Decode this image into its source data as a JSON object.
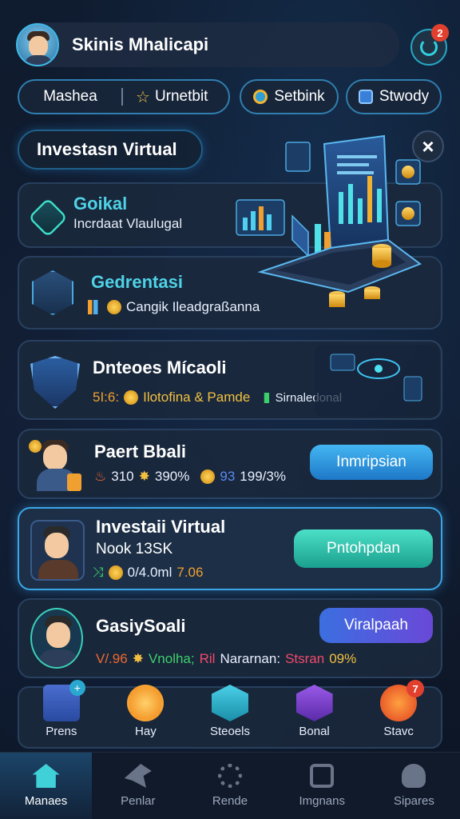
{
  "header": {
    "title": "Skinis Mhalicapi",
    "notification_count": "2"
  },
  "filters": {
    "seg1": "Mashea",
    "seg2": "Urnetbit",
    "pill2": "Setbink",
    "pill3": "Stwody"
  },
  "section": {
    "title": "Investasn Virtual",
    "close_icon": "×"
  },
  "cards": [
    {
      "title": "Goikal",
      "subtitle": "Incrdaat Vlaulugal",
      "title_color": "#4fd2e6"
    },
    {
      "title": "Gedrentasi",
      "subtitle": "Cangik Ileadgraßanna",
      "title_color": "#4fd2e6"
    },
    {
      "title": "Dnteoes Mícaoli",
      "stat1": "5Ι:6:",
      "stat2": "Ilotofina & Pamde",
      "stat3": "Sirnaledonal"
    },
    {
      "title": "Paert Bbali",
      "stat1": "310",
      "stat2": "390%",
      "stat3": "93",
      "stat4": "199/3%",
      "button": "Inmripsian"
    },
    {
      "title": "Investaii Virtual",
      "subtitle": "Nook 13SK",
      "stat1": "0/4.0ml",
      "stat2": "7.06",
      "button": "Pntohpdan"
    },
    {
      "title": "GasiySoali",
      "stat1": "V/.96",
      "stat2": "Vnolha;",
      "stat3": "Ril",
      "stat4": "Nararnan:",
      "stat5": "Stsran",
      "stat6": "09%",
      "button": "Viralpaah"
    }
  ],
  "quick_actions": [
    {
      "label": "Prens",
      "icon": "document-icon"
    },
    {
      "label": "Hay",
      "icon": "gear-coin-icon"
    },
    {
      "label": "Steoels",
      "icon": "hex-info-icon"
    },
    {
      "label": "Bonal",
      "icon": "search-hex-icon"
    },
    {
      "label": "Stavc",
      "icon": "shop-icon",
      "badge": "7"
    }
  ],
  "bottom_nav": [
    {
      "label": "Manaes",
      "icon": "home-icon",
      "active": true
    },
    {
      "label": "Penlar",
      "icon": "bird-icon"
    },
    {
      "label": "Rende",
      "icon": "settings-icon"
    },
    {
      "label": "Imgnans",
      "icon": "camera-icon"
    },
    {
      "label": "Sipares",
      "icon": "user-icon"
    }
  ],
  "colors": {
    "accent_cyan": "#3fd0d8",
    "accent_blue": "#3aa6e8",
    "gold": "#f2c040",
    "badge_red": "#e2402e",
    "background": "#0f1b2e"
  }
}
